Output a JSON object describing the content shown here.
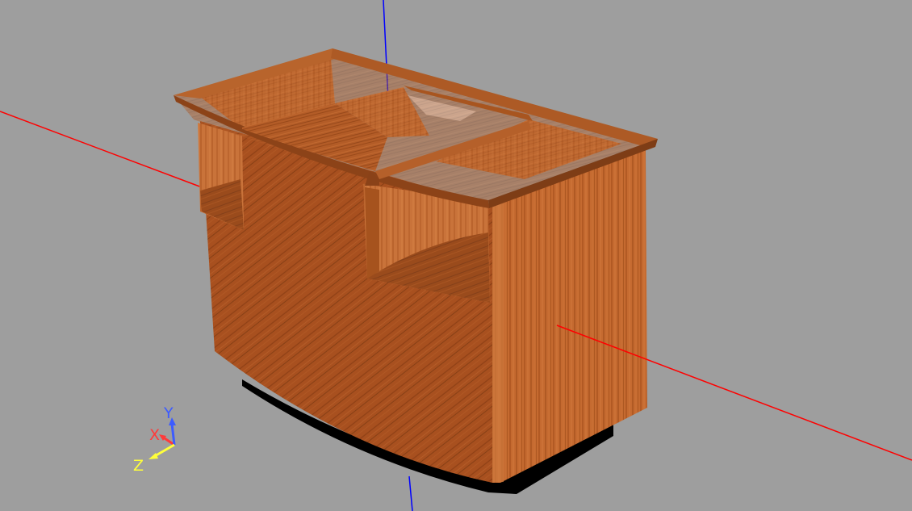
{
  "viewport": {
    "background_color": "#9e9e9e"
  },
  "scene_axes": {
    "x_axis_color": "#ff0000",
    "y_axis_color": "#0000ff"
  },
  "triad": {
    "x_label": "X",
    "y_label": "Y",
    "z_label": "Z",
    "x_color": "#ff3a3a",
    "y_color": "#3d5cff",
    "z_color": "#ffff3a"
  },
  "model": {
    "wood_color": "#b45a24",
    "shadow_color": "#000000"
  }
}
